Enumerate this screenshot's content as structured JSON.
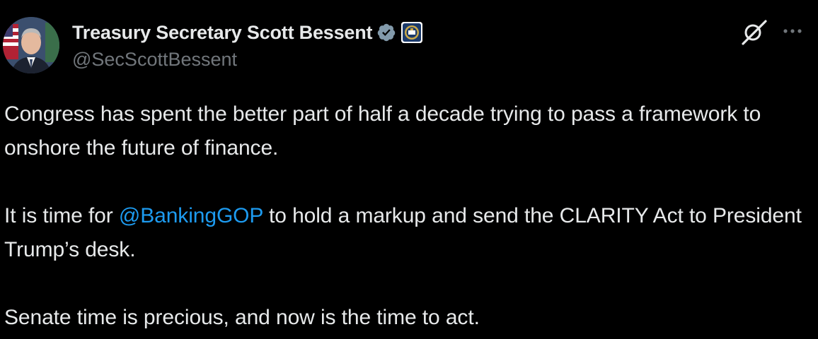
{
  "author": {
    "display_name": "Treasury Secretary Scott Bessent",
    "handle": "@SecScottBessent",
    "verified_badge_color": "#829aab",
    "affiliate_badge": "treasury-seal-icon"
  },
  "actions": {
    "grok_icon": "grok-slash-icon",
    "more_icon": "more-horizontal-icon"
  },
  "tweet": {
    "paragraph_1": "Congress has spent the better part of half a decade trying to pass a framework to onshore the future of finance.",
    "paragraph_2_before": "It is time for ",
    "paragraph_2_mention": "@BankingGOP",
    "paragraph_2_after": " to hold a markup and send the CLARITY Act to President Trump’s desk.",
    "paragraph_3": "Senate time is precious, and now is the time to act."
  },
  "colors": {
    "background": "#000000",
    "text": "#e7e9ea",
    "secondary_text": "#71767b",
    "link": "#1d9bf0"
  }
}
